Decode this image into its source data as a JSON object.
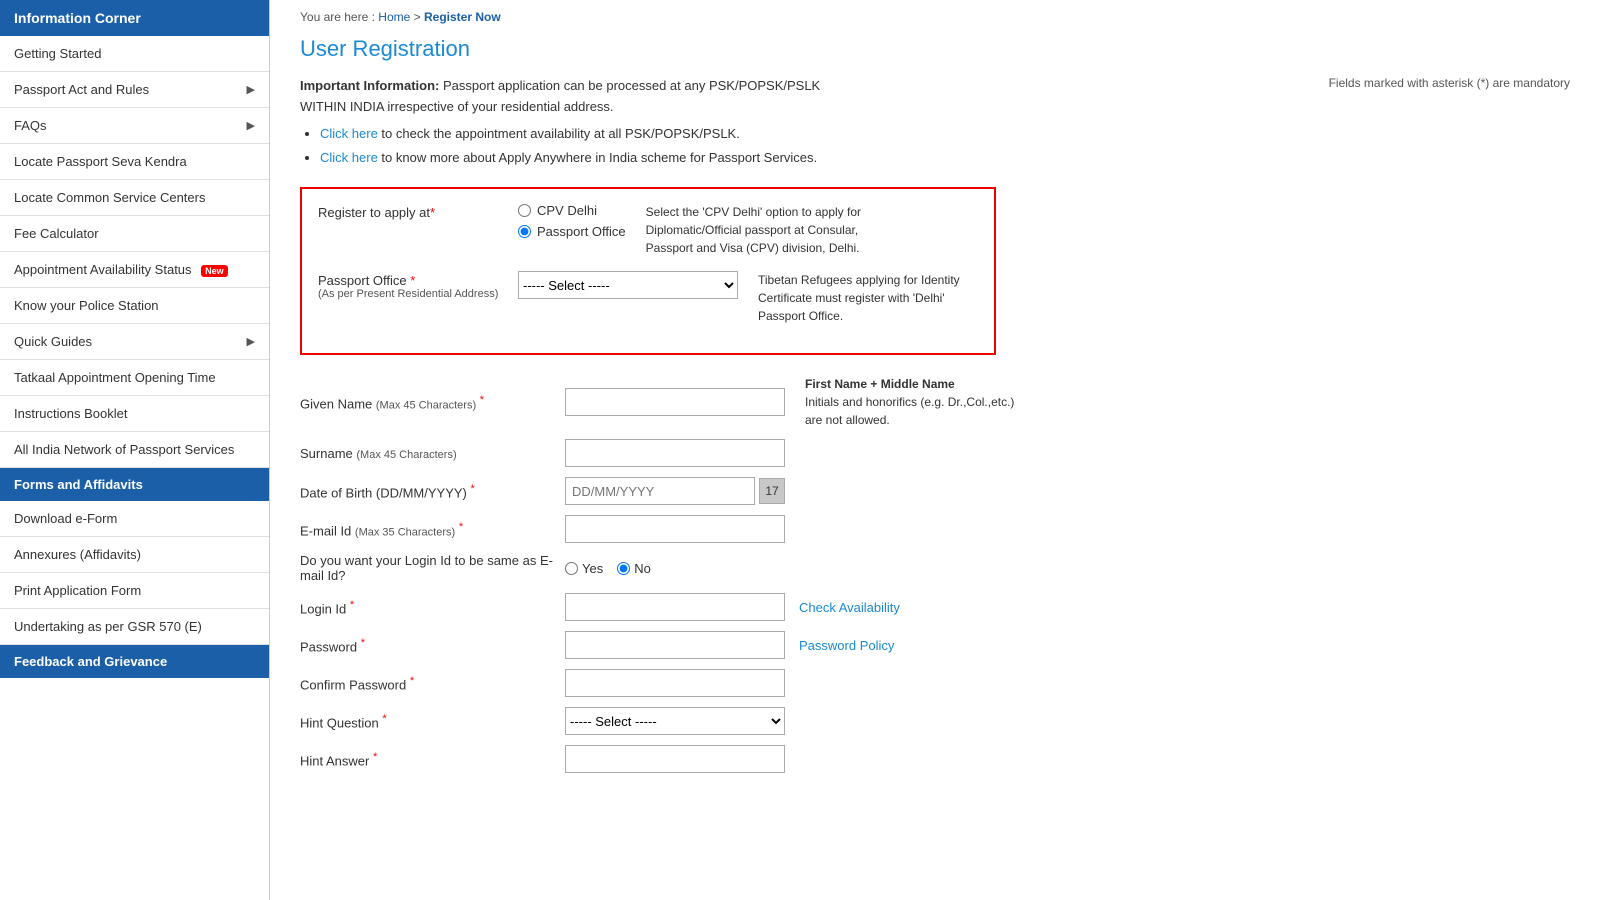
{
  "sidebar": {
    "header": "Information Corner",
    "items": [
      {
        "label": "Getting Started",
        "arrow": false,
        "active": false,
        "badge": null
      },
      {
        "label": "Passport Act and Rules",
        "arrow": true,
        "active": false,
        "badge": null
      },
      {
        "label": "FAQs",
        "arrow": true,
        "active": false,
        "badge": null
      },
      {
        "label": "Locate Passport Seva Kendra",
        "arrow": false,
        "active": false,
        "badge": null
      },
      {
        "label": "Locate Common Service Centers",
        "arrow": false,
        "active": false,
        "badge": null
      },
      {
        "label": "Fee Calculator",
        "arrow": false,
        "active": false,
        "badge": null
      },
      {
        "label": "Appointment Availability Status",
        "arrow": false,
        "active": false,
        "badge": "New"
      },
      {
        "label": "Know your Police Station",
        "arrow": false,
        "active": false,
        "badge": null
      },
      {
        "label": "Quick Guides",
        "arrow": true,
        "active": false,
        "badge": null
      },
      {
        "label": "Tatkaal Appointment Opening Time",
        "arrow": false,
        "active": false,
        "badge": null
      },
      {
        "label": "Instructions Booklet",
        "arrow": false,
        "active": false,
        "badge": null
      },
      {
        "label": "All India Network of Passport Services",
        "arrow": false,
        "active": false,
        "badge": null
      }
    ],
    "section2_header": "Forms and Affidavits",
    "section2_items": [
      {
        "label": "Download e-Form",
        "arrow": false,
        "active": false,
        "badge": null
      },
      {
        "label": "Annexures (Affidavits)",
        "arrow": false,
        "active": false,
        "badge": null
      },
      {
        "label": "Print Application Form",
        "arrow": false,
        "active": false,
        "badge": null
      },
      {
        "label": "Undertaking as per GSR 570 (E)",
        "arrow": false,
        "active": false,
        "badge": null
      }
    ],
    "section3_header": "Feedback and Grievance"
  },
  "breadcrumb": {
    "prefix": "You are here : ",
    "home": "Home",
    "separator": " > ",
    "current": "Register Now"
  },
  "page": {
    "title": "User Registration",
    "important_label": "Important Information:",
    "important_text": " Passport application can be processed at any PSK/POPSK/PSLK WITHIN INDIA irrespective of your residential address.",
    "click_link1_text": "Click here",
    "click_link1_rest": " to check the appointment availability at all PSK/POPSK/PSLK.",
    "click_link2_text": "Click here",
    "click_link2_rest": " to know more about Apply Anywhere in India scheme for Passport Services.",
    "mandatory_note": "Fields marked with asterisk (*) are mandatory"
  },
  "register_box": {
    "label": "Register to apply at",
    "required": true,
    "option1": "CPV Delhi",
    "option2": "Passport Office",
    "option2_selected": true,
    "hint": "Select the 'CPV Delhi' option to apply for Diplomatic/Official passport at Consular, Passport and Visa (CPV) division, Delhi.",
    "passport_office_label": "Passport Office",
    "passport_office_required": true,
    "passport_office_sub": "(As per Present Residential Address)",
    "passport_office_select": "----- Select -----",
    "passport_office_hint": "Tibetan Refugees applying for Identity Certificate must register with 'Delhi' Passport Office."
  },
  "form": {
    "given_name_label": "Given Name",
    "given_name_max": "(Max 45 Characters)",
    "given_name_hint_title": "First Name + Middle Name",
    "given_name_hint_text": "Initials and honorifics (e.g. Dr.,Col.,etc.) are not allowed.",
    "surname_label": "Surname",
    "surname_max": "(Max 45 Characters)",
    "dob_label": "Date of Birth (DD/MM/YYYY)",
    "dob_placeholder": "DD/MM/YYYY",
    "email_label": "E-mail Id",
    "email_max": "(Max 35 Characters)",
    "login_same_label": "Do you want your Login Id",
    "login_same_label2": " to be same as E-mail Id?",
    "login_same_yes": "Yes",
    "login_same_no": "No",
    "login_same_no_selected": true,
    "login_id_label": "Login Id",
    "check_availability": "Check Availability",
    "password_label": "Password",
    "password_policy": "Password Policy",
    "confirm_password_label": "Confirm Password",
    "hint_question_label": "Hint Question",
    "hint_question_select": "----- Select -----",
    "hint_answer_label": "Hint Answer"
  }
}
